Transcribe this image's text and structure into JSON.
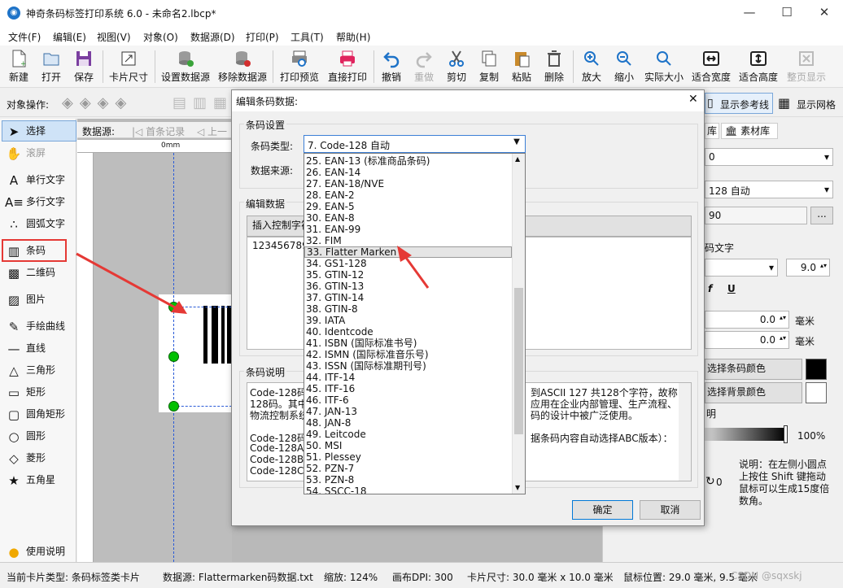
{
  "window": {
    "title": "神奇条码标签打印系统 6.0 - 未命名2.lbcp*",
    "minimize": "—",
    "maximize": "☐",
    "close": "✕"
  },
  "menu": [
    "文件(F)",
    "编辑(E)",
    "视图(V)",
    "对象(O)",
    "数据源(D)",
    "打印(P)",
    "工具(T)",
    "帮助(H)"
  ],
  "toolbar": [
    {
      "label": "新建",
      "icon": "new-file-icon"
    },
    {
      "label": "打开",
      "icon": "open-folder-icon"
    },
    {
      "label": "保存",
      "icon": "save-icon"
    },
    {
      "label": "卡片尺寸",
      "icon": "card-size-icon"
    },
    {
      "label": "设置数据源",
      "icon": "database-settings-icon"
    },
    {
      "label": "移除数据源",
      "icon": "database-remove-icon"
    },
    {
      "label": "打印预览",
      "icon": "print-preview-icon"
    },
    {
      "label": "直接打印",
      "icon": "printer-icon"
    },
    {
      "label": "撤销",
      "icon": "undo-icon"
    },
    {
      "label": "重做",
      "icon": "redo-icon"
    },
    {
      "label": "剪切",
      "icon": "scissors-icon"
    },
    {
      "label": "复制",
      "icon": "copy-icon"
    },
    {
      "label": "粘贴",
      "icon": "paste-icon"
    },
    {
      "label": "删除",
      "icon": "trash-icon"
    },
    {
      "label": "放大",
      "icon": "zoom-in-icon"
    },
    {
      "label": "缩小",
      "icon": "zoom-out-icon"
    },
    {
      "label": "实际大小",
      "icon": "actual-size-icon"
    },
    {
      "label": "适合宽度",
      "icon": "fit-width-icon"
    },
    {
      "label": "适合高度",
      "icon": "fit-height-icon"
    },
    {
      "label": "整页显示",
      "icon": "full-page-icon"
    }
  ],
  "toolbar2": {
    "object_ops": "对象操作:",
    "show_guides": "显示参考线",
    "show_grid": "显示网格"
  },
  "datasource_bar": {
    "label": "数据源:",
    "first": "首条记录",
    "prev": "上一"
  },
  "left_tools": [
    "选择",
    "滚屏",
    "单行文字",
    "多行文字",
    "圆弧文字",
    "条码",
    "二维码",
    "图片",
    "手绘曲线",
    "直线",
    "三角形",
    "矩形",
    "圆角矩形",
    "圆形",
    "菱形",
    "五角星"
  ],
  "help": "使用说明",
  "ruler": {
    "zero": "0mm"
  },
  "right_panel": {
    "tab_lib": "库",
    "tab_material": "素材库",
    "field1": "0",
    "barcode_type": "128 自动",
    "data_value": "90",
    "more": "...",
    "code_text": "码文字",
    "font_size": "9.0",
    "bold": "f",
    "underline": "U",
    "x_offset": "0.0",
    "x_unit": "毫米",
    "y_offset": "0.0",
    "y_unit": "毫米",
    "barcode_color_btn": "选择条码颜色",
    "barcode_color": "#000000",
    "bg_color_btn": "选择背景颜色",
    "bg_color": "#ffffff",
    "transparent_label": "明",
    "opacity": "100%",
    "rotate": "0",
    "hint": "说明：在左侧小圆点上按住 Shift 键拖动鼠标可以生成15度倍数角。"
  },
  "dialog": {
    "title": "编辑条码数据:",
    "close": "✕",
    "group_barcode_settings": "条码设置",
    "barcode_type_label": "条码类型:",
    "barcode_type_value": "7.  Code-128 自动",
    "data_source_label": "数据来源:",
    "group_edit_data": "编辑数据",
    "insert_control": "插入控制字符",
    "data_text": "123456789",
    "group_description": "条码说明",
    "desc_line1_left": "Code-128码",
    "desc_line1_right": "到ASCII 127 共128个字符，故称",
    "desc_line2_left": "128码。其中",
    "desc_line2_right": "应用在企业内部管理、生产流程、",
    "desc_line3_left": "物流控制系统",
    "desc_line3_right": "码的设计中被广泛使用。",
    "desc_line4_left": "Code-128码",
    "desc_line4_right": "据条码内容自动选择ABC版本）：",
    "desc_line5": "Code-128A:",
    "desc_line6": "Code-128B:",
    "desc_line7": "Code-128C:",
    "ok": "确定",
    "cancel": "取消"
  },
  "dropdown": {
    "items": [
      "25.  EAN-13 (标准商品条码)",
      "26.  EAN-14",
      "27.  EAN-18/NVE",
      "28.  EAN-2",
      "29.  EAN-5",
      "30.  EAN-8",
      "31.  EAN-99",
      "32.  FIM",
      "33.  Flatter Marken",
      "34.  GS1-128",
      "35.  GTIN-12",
      "36.  GTIN-13",
      "37.  GTIN-14",
      "38.  GTIN-8",
      "39.  IATA",
      "40.  Identcode",
      "41.  ISBN (国际标准书号)",
      "42.  ISMN (国际标准音乐号)",
      "43.  ISSN (国际标准期刊号)",
      "44.  ITF-14",
      "45.  ITF-16",
      "46.  ITF-6",
      "47.  JAN-13",
      "48.  JAN-8",
      "49.  Leitcode",
      "50.  MSI",
      "51.  Plessey",
      "52.  PZN-7",
      "53.  PZN-8",
      "54.  SSCC-18"
    ],
    "selected_index": 8
  },
  "status": {
    "card_type": "当前卡片类型:  条码标签类卡片",
    "datasource": "数据源:  Flattermarken码数据.txt",
    "zoom": "缩放:  124%",
    "dpi": "画布DPI:  300",
    "card_size": "卡片尺寸:  30.0 毫米 x 10.0 毫米",
    "mouse_pos": "鼠标位置:  29.0 毫米,  9.5 毫米",
    "watermark": "CSDN @sqxskj"
  },
  "colors": {
    "accent_red": "#e53935",
    "selection_green": "#00c000",
    "guide_blue": "#2a5bd7"
  }
}
